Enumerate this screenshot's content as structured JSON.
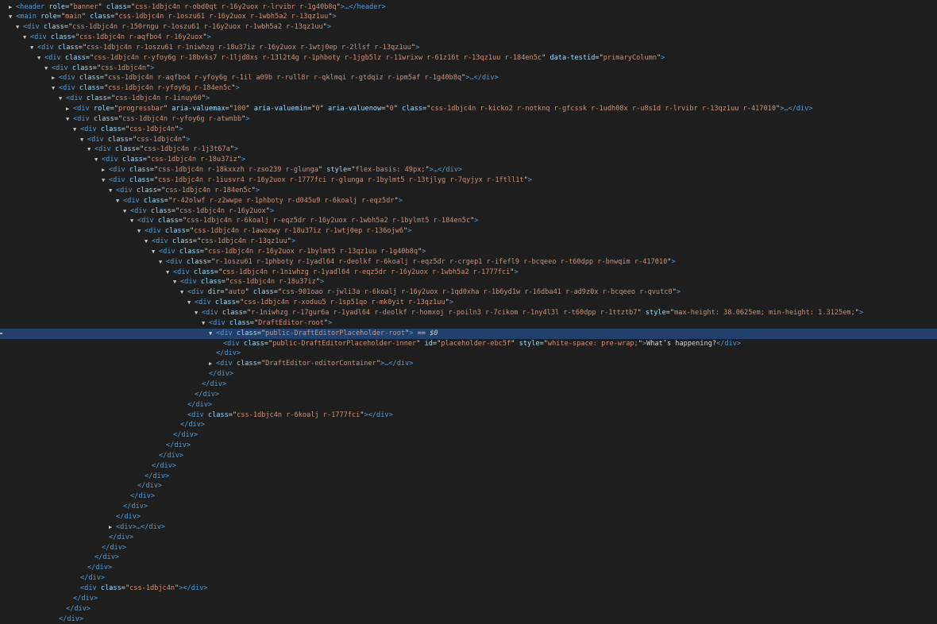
{
  "elements_panel": {
    "selected_marker": "== $0",
    "rows": [
      {
        "d": 4,
        "t": "c",
        "open": "<header",
        "attrs": [
          [
            "role",
            "banner"
          ],
          [
            "class",
            "css-1dbjc4n r-obd0qt r-16y2uox r-lrvibr r-1g40b8q"
          ]
        ],
        "tail": ">…</header>"
      },
      {
        "d": 4,
        "t": "o",
        "open": "<main",
        "attrs": [
          [
            "role",
            "main"
          ],
          [
            "class",
            "css-1dbjc4n r-1oszu61 r-16y2uox r-1wbh5a2 r-13qz1uu"
          ]
        ],
        "tail": ">"
      },
      {
        "d": 5,
        "t": "o",
        "open": "<div",
        "attrs": [
          [
            "class",
            "css-1dbjc4n r-150rngu r-1oszu61 r-16y2uox r-1wbh5a2 r-13qz1uu"
          ]
        ],
        "tail": ">"
      },
      {
        "d": 6,
        "t": "o",
        "open": "<div",
        "attrs": [
          [
            "class",
            "css-1dbjc4n r-aqfbo4 r-16y2uox"
          ]
        ],
        "tail": ">"
      },
      {
        "d": 7,
        "t": "o",
        "open": "<div",
        "attrs": [
          [
            "class",
            "css-1dbjc4n r-1oszu61 r-1niwhzg r-18u37iz r-16y2uox r-1wtj0ep r-2llsf r-13qz1uu"
          ]
        ],
        "tail": ">"
      },
      {
        "d": 8,
        "t": "o",
        "open": "<div",
        "attrs": [
          [
            "class",
            "css-1dbjc4n r-yfoy6g r-18bvks7 r-1ljd8xs r-13l2t4g r-1phboty r-1jgb5lz r-11wrixw r-61z16t r-13qz1uu r-184en5c"
          ],
          [
            "data-testid",
            "primaryColumn"
          ]
        ],
        "tail": ">"
      },
      {
        "d": 9,
        "t": "o",
        "open": "<div",
        "attrs": [
          [
            "class",
            "css-1dbjc4n"
          ]
        ],
        "tail": ">"
      },
      {
        "d": 10,
        "t": "c",
        "open": "<div",
        "attrs": [
          [
            "class",
            "css-1dbjc4n r-aqfbo4 r-yfoy6g r-1il a09b r-rull8r r-qklmqi r-gtdqiz r-ipm5af r-1g40b8q"
          ]
        ],
        "tail": ">…</div>"
      },
      {
        "d": 10,
        "t": "o",
        "open": "<div",
        "attrs": [
          [
            "class",
            "css-1dbjc4n r-yfoy6g r-184en5c"
          ]
        ],
        "tail": ">"
      },
      {
        "d": 11,
        "t": "o",
        "open": "<div",
        "attrs": [
          [
            "class",
            "css-1dbjc4n r-1inuy60"
          ]
        ],
        "tail": ">"
      },
      {
        "d": 12,
        "t": "c",
        "open": "<div",
        "attrs": [
          [
            "role",
            "progressbar"
          ],
          [
            "aria-valuemax",
            "100"
          ],
          [
            "aria-valuemin",
            "0"
          ],
          [
            "aria-valuenow",
            "0"
          ],
          [
            "class",
            "css-1dbjc4n r-kicko2 r-notknq r-gfcssk r-1udh08x r-u8s1d r-lrvibr r-13qz1uu r-417010"
          ]
        ],
        "tail": ">…</div>"
      },
      {
        "d": 12,
        "t": "o",
        "open": "<div",
        "attrs": [
          [
            "class",
            "css-1dbjc4n r-yfoy6g r-atwnbb"
          ]
        ],
        "tail": ">"
      },
      {
        "d": 13,
        "t": "o",
        "open": "<div",
        "attrs": [
          [
            "class",
            "css-1dbjc4n"
          ]
        ],
        "tail": ">"
      },
      {
        "d": 14,
        "t": "o",
        "open": "<div",
        "attrs": [
          [
            "class",
            "css-1dbjc4n"
          ]
        ],
        "tail": ">"
      },
      {
        "d": 15,
        "t": "o",
        "open": "<div",
        "attrs": [
          [
            "class",
            "css-1dbjc4n r-1j3t67a"
          ]
        ],
        "tail": ">"
      },
      {
        "d": 16,
        "t": "o",
        "open": "<div",
        "attrs": [
          [
            "class",
            "css-1dbjc4n r-18u37iz"
          ]
        ],
        "tail": ">"
      },
      {
        "d": 17,
        "t": "c",
        "open": "<div",
        "attrs": [
          [
            "class",
            "css-1dbjc4n r-18kxxzh r-zso239 r-glunga"
          ],
          [
            "style",
            "flex-basis: 49px;"
          ]
        ],
        "tail": ">…</div>"
      },
      {
        "d": 17,
        "t": "o",
        "open": "<div",
        "attrs": [
          [
            "class",
            "css-1dbjc4n r-1iusvr4 r-16y2uox r-1777fci r-glunga r-1bylmt5 r-13tjlyg r-7qyjyx r-1ftll1t"
          ]
        ],
        "tail": ">"
      },
      {
        "d": 18,
        "t": "o",
        "open": "<div",
        "attrs": [
          [
            "class",
            "css-1dbjc4n r-184en5c"
          ]
        ],
        "tail": ">"
      },
      {
        "d": 19,
        "t": "o",
        "open": "<div",
        "attrs": [
          [
            "class",
            "r-42olwf r-z2wwpe r-1phboty r-d045u9 r-6koalj r-eqz5dr"
          ]
        ],
        "tail": ">"
      },
      {
        "d": 20,
        "t": "o",
        "open": "<div",
        "attrs": [
          [
            "class",
            "css-1dbjc4n r-16y2uox"
          ]
        ],
        "tail": ">"
      },
      {
        "d": 21,
        "t": "o",
        "open": "<div",
        "attrs": [
          [
            "class",
            "css-1dbjc4n r-6koalj r-eqz5dr r-16y2uox r-1wbh5a2 r-1bylmt5 r-184en5c"
          ]
        ],
        "tail": ">"
      },
      {
        "d": 22,
        "t": "o",
        "open": "<div",
        "attrs": [
          [
            "class",
            "css-1dbjc4n r-1awozwy r-18u37iz r-1wtj0ep r-136ojw6"
          ]
        ],
        "tail": ">"
      },
      {
        "d": 23,
        "t": "o",
        "open": "<div",
        "attrs": [
          [
            "class",
            "css-1dbjc4n r-13qz1uu"
          ]
        ],
        "tail": ">"
      },
      {
        "d": 24,
        "t": "o",
        "open": "<div",
        "attrs": [
          [
            "class",
            "css-1dbjc4n r-16y2uox r-1bylmt5 r-13qz1uu r-1g40b8q"
          ]
        ],
        "tail": ">"
      },
      {
        "d": 25,
        "t": "o",
        "open": "<div",
        "attrs": [
          [
            "class",
            "r-1oszu61 r-1phboty r-1yadl64 r-deolkf r-6koalj r-eqz5dr r-crgep1 r-ifefl9 r-bcqeeo r-t60dpp r-bnwqim r-417010"
          ]
        ],
        "tail": ">"
      },
      {
        "d": 26,
        "t": "o",
        "open": "<div",
        "attrs": [
          [
            "class",
            "css-1dbjc4n r-1niwhzg r-1yadl64 r-eqz5dr r-16y2uox r-1wbh5a2 r-1777fci"
          ]
        ],
        "tail": ">"
      },
      {
        "d": 27,
        "t": "o",
        "open": "<div",
        "attrs": [
          [
            "class",
            "css-1dbjc4n r-18u37iz"
          ]
        ],
        "tail": ">"
      },
      {
        "d": 28,
        "t": "o",
        "open": "<div",
        "attrs": [
          [
            "dir",
            "auto"
          ],
          [
            "class",
            "css-901oao r-jwli3a r-6koalj r-16y2uox r-1qd0xha r-1b6yd1w r-16dba41 r-ad9z0x r-bcqeeo r-qvutc0"
          ]
        ],
        "tail": ">"
      },
      {
        "d": 29,
        "t": "o",
        "open": "<div",
        "attrs": [
          [
            "class",
            "css-1dbjc4n r-xoduu5 r-1sp51qo r-mk0yit r-13qz1uu"
          ]
        ],
        "tail": ">"
      },
      {
        "d": 30,
        "t": "o",
        "open": "<div",
        "attrs": [
          [
            "class",
            "r-1niwhzg r-17gur6a r-1yadl64 r-deolkf r-homxoj r-poiln3 r-7cikom r-1ny4l3l r-t60dpp r-1ttztb7"
          ],
          [
            "style",
            "max-height: 38.0625em; min-height: 1.3125em;"
          ]
        ],
        "tail": ">"
      },
      {
        "d": 31,
        "t": "o",
        "open": "<div",
        "attrs": [
          [
            "class",
            "DraftEditor-root"
          ]
        ],
        "tail": ">"
      },
      {
        "d": 32,
        "t": "o",
        "sel": true,
        "open": "<div",
        "attrs": [
          [
            "class",
            "public-DraftEditorPlaceholder-root"
          ]
        ],
        "tail": ">"
      },
      {
        "d": 33,
        "t": "n",
        "open": "<div",
        "attrs": [
          [
            "class",
            "public-DraftEditorPlaceholder-inner"
          ],
          [
            "id",
            "placeholder-ebc5f"
          ],
          [
            "style",
            "white-space: pre-wrap;"
          ]
        ],
        "tail": ">",
        "text": "What’s happening?",
        "close": "</div>"
      },
      {
        "d": 32,
        "t": "n",
        "open": "</div>",
        "attrs": [],
        "tail": ""
      },
      {
        "d": 32,
        "t": "c",
        "open": "<div",
        "attrs": [
          [
            "class",
            "DraftEditor-editorContainer"
          ]
        ],
        "tail": ">…</div>"
      },
      {
        "d": 31,
        "t": "n",
        "open": "</div>",
        "attrs": [],
        "tail": ""
      },
      {
        "d": 30,
        "t": "n",
        "open": "</div>",
        "attrs": [],
        "tail": ""
      },
      {
        "d": 29,
        "t": "n",
        "open": "</div>",
        "attrs": [],
        "tail": ""
      },
      {
        "d": 28,
        "t": "n",
        "open": "</div>",
        "attrs": [],
        "tail": ""
      },
      {
        "d": 28,
        "t": "n",
        "open": "<div",
        "attrs": [
          [
            "class",
            "css-1dbjc4n r-6koalj r-1777fci"
          ]
        ],
        "tail": "></div>"
      },
      {
        "d": 27,
        "t": "n",
        "open": "</div>",
        "attrs": [],
        "tail": ""
      },
      {
        "d": 26,
        "t": "n",
        "open": "</div>",
        "attrs": [],
        "tail": ""
      },
      {
        "d": 25,
        "t": "n",
        "open": "</div>",
        "attrs": [],
        "tail": ""
      },
      {
        "d": 24,
        "t": "n",
        "open": "</div>",
        "attrs": [],
        "tail": ""
      },
      {
        "d": 23,
        "t": "n",
        "open": "</div>",
        "attrs": [],
        "tail": ""
      },
      {
        "d": 22,
        "t": "n",
        "open": "</div>",
        "attrs": [],
        "tail": ""
      },
      {
        "d": 21,
        "t": "n",
        "open": "</div>",
        "attrs": [],
        "tail": ""
      },
      {
        "d": 20,
        "t": "n",
        "open": "</div>",
        "attrs": [],
        "tail": ""
      },
      {
        "d": 19,
        "t": "n",
        "open": "</div>",
        "attrs": [],
        "tail": ""
      },
      {
        "d": 18,
        "t": "n",
        "open": "</div>",
        "attrs": [],
        "tail": ""
      },
      {
        "d": 18,
        "t": "c",
        "open": "<div>",
        "attrs": [],
        "tail": "…</div>"
      },
      {
        "d": 17,
        "t": "n",
        "open": "</div>",
        "attrs": [],
        "tail": ""
      },
      {
        "d": 16,
        "t": "n",
        "open": "</div>",
        "attrs": [],
        "tail": ""
      },
      {
        "d": 15,
        "t": "n",
        "open": "</div>",
        "attrs": [],
        "tail": ""
      },
      {
        "d": 14,
        "t": "n",
        "open": "</div>",
        "attrs": [],
        "tail": ""
      },
      {
        "d": 13,
        "t": "n",
        "open": "</div>",
        "attrs": [],
        "tail": ""
      },
      {
        "d": 13,
        "t": "n",
        "open": "<div",
        "attrs": [
          [
            "class",
            "css-1dbjc4n"
          ]
        ],
        "tail": "></div>"
      },
      {
        "d": 12,
        "t": "n",
        "open": "</div>",
        "attrs": [],
        "tail": ""
      },
      {
        "d": 11,
        "t": "n",
        "open": "</div>",
        "attrs": [],
        "tail": ""
      },
      {
        "d": 10,
        "t": "n",
        "open": "</div>",
        "attrs": [],
        "tail": ""
      }
    ]
  }
}
